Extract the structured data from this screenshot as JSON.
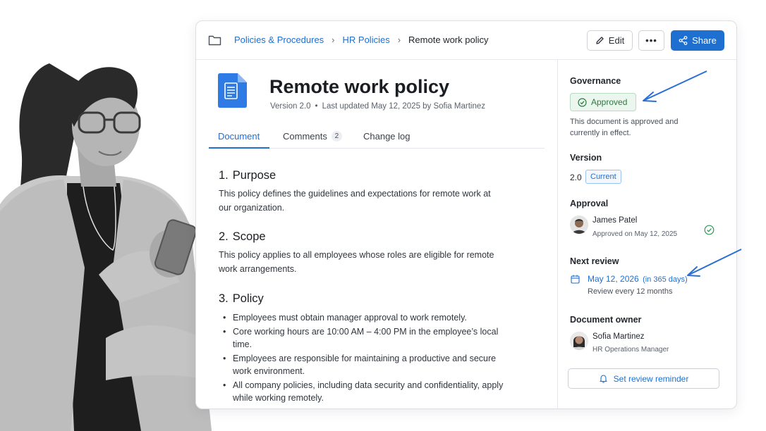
{
  "breadcrumb": {
    "items": [
      "Policies & Procedures",
      "HR Policies"
    ],
    "current": "Remote work policy"
  },
  "toolbar": {
    "edit_label": "Edit",
    "more_label": "•••",
    "share_label": "Share"
  },
  "document": {
    "title": "Remote work policy",
    "version": "Version 2.0",
    "updated": "Last updated May 12, 2025 by Sofia Martinez"
  },
  "tabs": [
    {
      "label": "Document",
      "active": true
    },
    {
      "label": "Comments",
      "count": "2"
    },
    {
      "label": "Change log"
    }
  ],
  "sections": [
    {
      "num": "1.",
      "title": "Purpose",
      "text": "This policy defines the guidelines and expectations for remote work at our organization."
    },
    {
      "num": "2.",
      "title": "Scope",
      "text": "This policy applies to all employees whose roles are eligible for remote work arrangements."
    },
    {
      "num": "3.",
      "title": "Policy",
      "bullets": [
        "Employees must obtain manager approval to work remotely.",
        "Core working hours are 10:00 AM – 4:00 PM in the employee’s local time.",
        "Employees are responsible for maintaining a productive and secure work environment.",
        "All company policies, including data security and confidentiality, apply while working remotely."
      ]
    }
  ],
  "sidebar": {
    "governance": {
      "heading": "Governance",
      "status": "Approved",
      "description": "This document is approved and currently in effect."
    },
    "version": {
      "heading": "Version",
      "number": "2.0",
      "badge": "Current"
    },
    "approval": {
      "heading": "Approval",
      "name": "James Patel",
      "sub": "Approved on May 12, 2025"
    },
    "next_review": {
      "heading": "Next review",
      "date": "May 12, 2026",
      "relative": "(in 365 days)",
      "frequency": "Review every 12 months"
    },
    "owner": {
      "heading": "Document owner",
      "name": "Sofia Martinez",
      "role": "HR Operations Manager"
    },
    "reminder_label": "Set review reminder"
  },
  "colors": {
    "accent": "#1f6fd1",
    "approved_green": "#2d7a45",
    "arrow_blue": "#2a6fd6"
  },
  "icons": [
    "folder-icon",
    "pencil-icon",
    "share-icon",
    "document-icon",
    "check-circle-icon",
    "calendar-icon",
    "bell-icon"
  ]
}
